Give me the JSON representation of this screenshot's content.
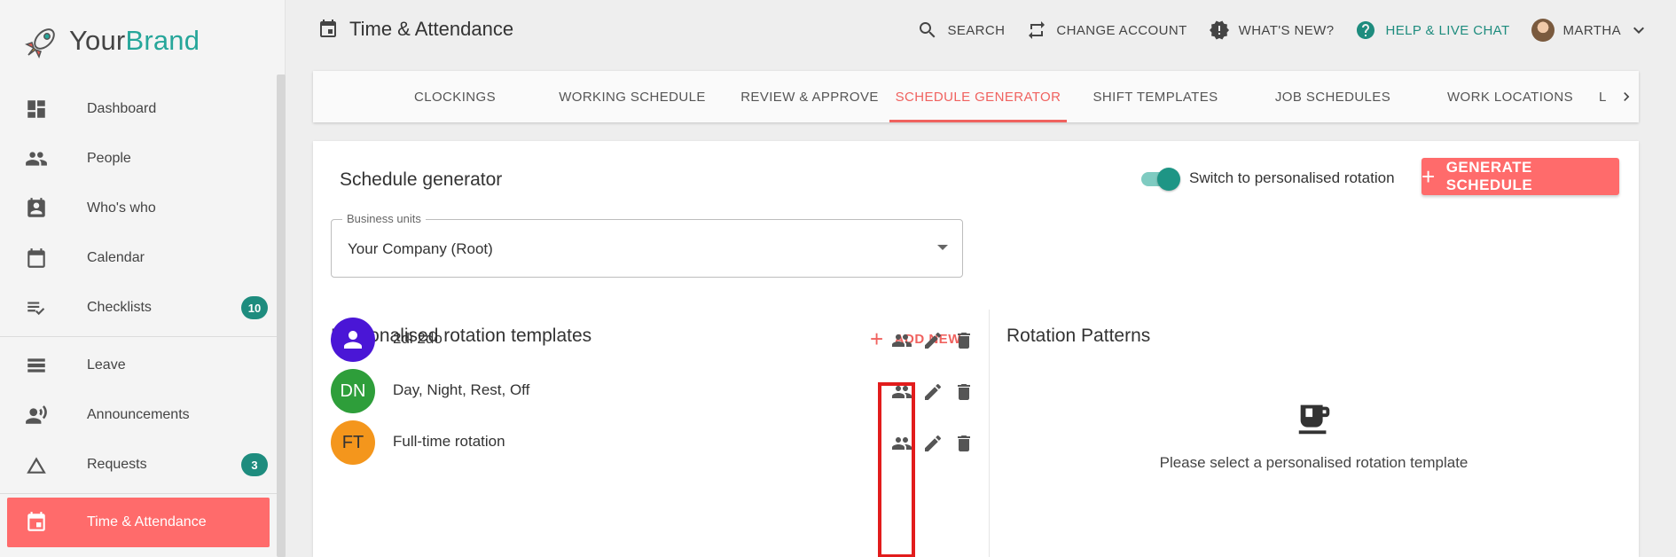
{
  "brand": {
    "name_part1": "Your",
    "name_part2": "Brand"
  },
  "sidebar": {
    "items": [
      {
        "label": "Dashboard",
        "icon": "dashboard-icon"
      },
      {
        "label": "People",
        "icon": "people-icon"
      },
      {
        "label": "Who's who",
        "icon": "badge-icon"
      },
      {
        "label": "Calendar",
        "icon": "calendar-icon"
      },
      {
        "label": "Checklists",
        "icon": "checklist-icon",
        "badge": "10"
      },
      {
        "label": "Leave",
        "icon": "leave-icon"
      },
      {
        "label": "Announcements",
        "icon": "announcement-icon"
      },
      {
        "label": "Requests",
        "icon": "triangle-icon",
        "badge": "3"
      },
      {
        "label": "Time & Attendance",
        "icon": "calendar-event-icon",
        "active": true
      }
    ]
  },
  "header": {
    "title": "Time & Attendance",
    "actions": {
      "search": "SEARCH",
      "change_account": "CHANGE ACCOUNT",
      "whats_new": "WHAT'S NEW?",
      "help": "HELP & LIVE CHAT",
      "user": "MARTHA"
    }
  },
  "tabs": [
    {
      "label": "CLOCKINGS"
    },
    {
      "label": "WORKING SCHEDULE"
    },
    {
      "label": "REVIEW & APPROVE"
    },
    {
      "label": "SCHEDULE GENERATOR",
      "active": true
    },
    {
      "label": "SHIFT TEMPLATES"
    },
    {
      "label": "JOB SCHEDULES"
    },
    {
      "label": "WORK LOCATIONS"
    },
    {
      "label": "L"
    }
  ],
  "main": {
    "title": "Schedule generator",
    "toggle_label": "Switch to personalised rotation",
    "toggle_on": true,
    "generate_button": "GENERATE SCHEDULE",
    "business_units": {
      "label": "Business units",
      "value": "Your Company (Root)"
    },
    "templates": {
      "title": "Personalised rotation templates",
      "add_new": "ADD NEW",
      "items": [
        {
          "initials": "",
          "name": "2di 2do",
          "color": "#4a16d6"
        },
        {
          "initials": "DN",
          "name": "Day, Night, Rest, Off",
          "color": "#2e9e3a"
        },
        {
          "initials": "FT",
          "name": "Full-time rotation",
          "color": "#f4961c"
        }
      ]
    },
    "patterns": {
      "title": "Rotation Patterns",
      "empty_text": "Please select a personalised rotation template"
    }
  },
  "colors": {
    "accent": "#ff6b6b",
    "teal": "#1e8c7e",
    "highlight": "#e21c1c"
  }
}
